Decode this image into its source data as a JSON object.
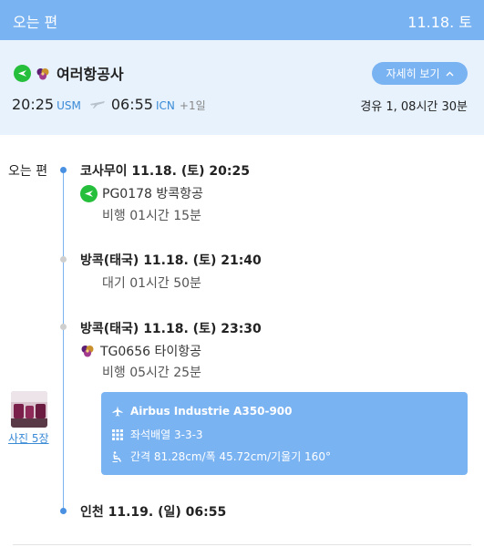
{
  "header": {
    "title": "오는 편",
    "date": "11.18. 토"
  },
  "summary": {
    "airline": "여러항공사",
    "detail_button": "자세히 보기",
    "depart_time": "20:25",
    "depart_code": "USM",
    "arrive_time": "06:55",
    "arrive_code": "ICN",
    "day_offset": "+1일",
    "stops": "경유 1, 08시간 30분"
  },
  "timeline": {
    "label": "오는 편",
    "departure": "코사무이 11.18. (토) 20:25",
    "flight1": {
      "flight": "PG0178 방콕항공",
      "duration": "비행 01시간 15분"
    },
    "layover_arrive": "방콕(태국) 11.18. (토) 21:40",
    "layover_wait": "대기 01시간 50분",
    "layover_depart": "방콕(태국) 11.18. (토) 23:30",
    "flight2": {
      "flight": "TG0656 타이항공",
      "duration": "비행 05시간 25분"
    },
    "arrival": "인천 11.19. (일) 06:55"
  },
  "photos": {
    "link": "사진 5장"
  },
  "aircraft": {
    "model": "Airbus Industrie A350-900",
    "seats": "좌석배열 3-3-3",
    "pitch": "간격 81.28cm/폭 45.72cm/기울기 160°"
  },
  "icons": {
    "pg_airline": "bangkok-airways-logo-icon",
    "tg_airline": "thai-airways-logo-icon",
    "plane": "plane-icon",
    "chevron": "chevron-up-icon",
    "seat_grid": "seat-grid-icon",
    "recline": "recline-seat-icon"
  },
  "colors": {
    "accent": "#7ab3f2",
    "summary_bg": "#e7f2fd",
    "pg_green": "#25bf3c",
    "tg_purple": "#5b1e72",
    "tg_gold": "#c9902c",
    "link_blue": "#3a8ad6"
  }
}
